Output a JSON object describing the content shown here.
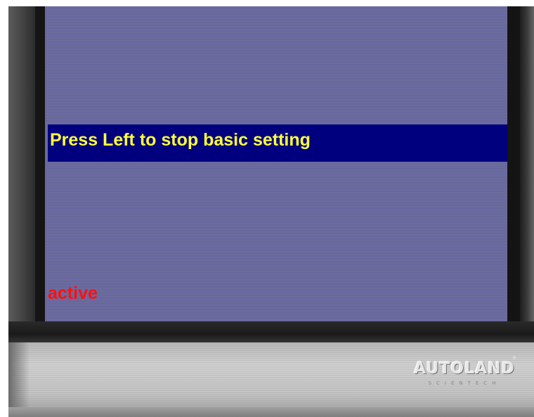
{
  "screen": {
    "message": "Press Left to stop basic setting",
    "status": "active"
  },
  "brand": {
    "name": "AUTOLAND",
    "tagline": "SCIENTECH",
    "registered": "®"
  },
  "colors": {
    "screen_background": "#6b6b9c",
    "banner_background": "#00007e",
    "banner_text": "#ffff3a",
    "status_text": "#ff1010"
  }
}
